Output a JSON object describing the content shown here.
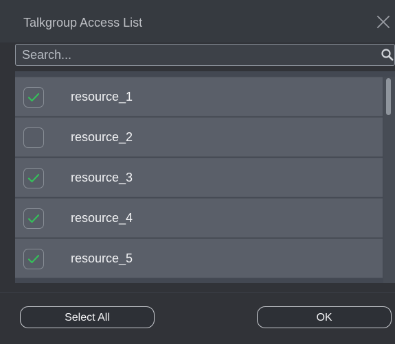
{
  "dialog": {
    "title": "Talkgroup Access List",
    "close_icon": "close-icon"
  },
  "search": {
    "placeholder": "Search...",
    "value": "",
    "icon": "search-icon"
  },
  "list": {
    "items": [
      {
        "label": "resource_1",
        "checked": true
      },
      {
        "label": "resource_2",
        "checked": false
      },
      {
        "label": "resource_3",
        "checked": true
      },
      {
        "label": "resource_4",
        "checked": true
      },
      {
        "label": "resource_5",
        "checked": true
      }
    ],
    "check_icon": "checkmark-icon",
    "check_color": "#35c05a"
  },
  "footer": {
    "select_all_label": "Select All",
    "ok_label": "OK"
  },
  "colors": {
    "dialog_bg": "#313338",
    "titlebar_bg": "#363a40",
    "row_bg": "#5a5f69",
    "text": "#f2f3f5"
  }
}
